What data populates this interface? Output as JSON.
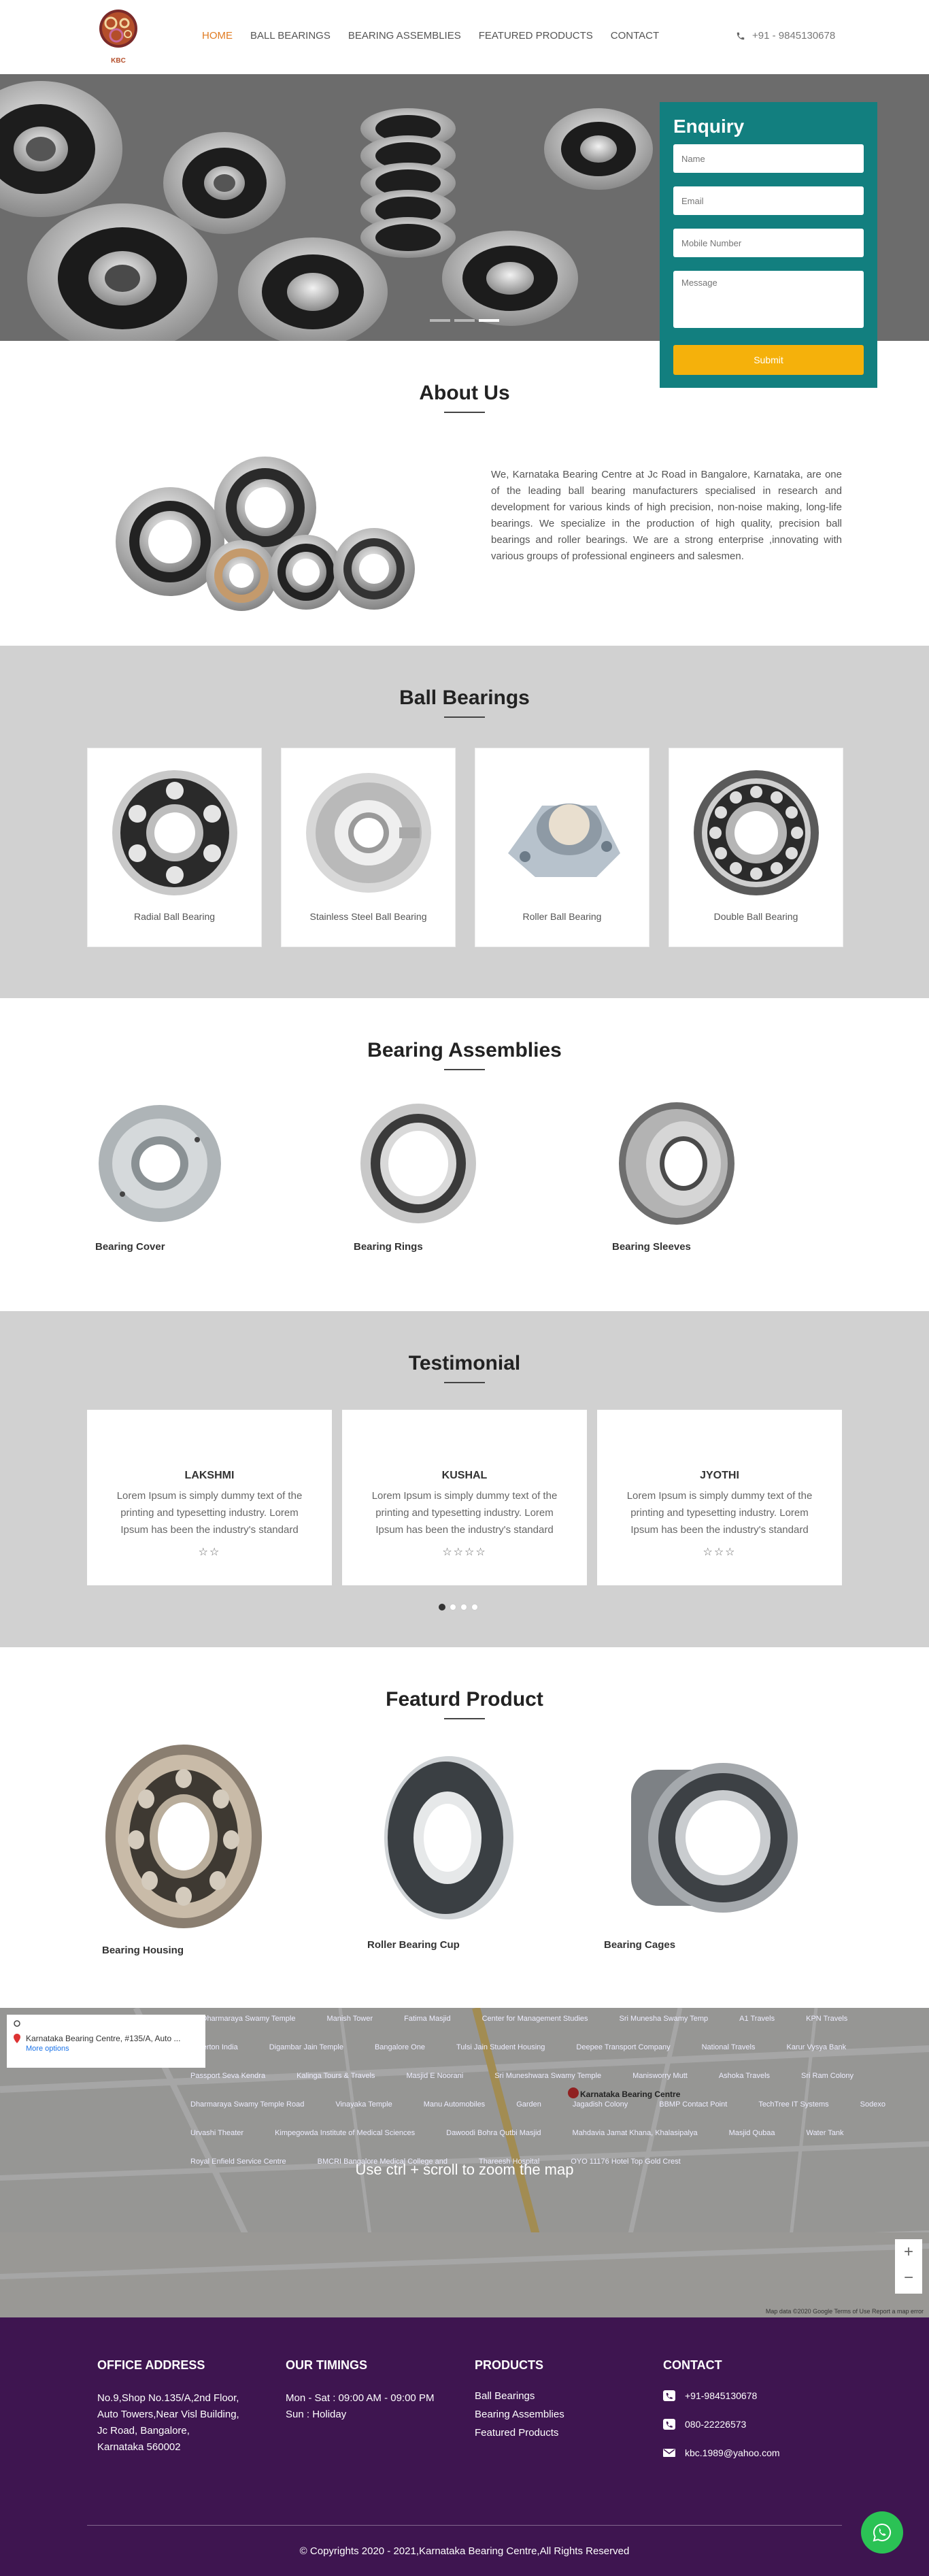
{
  "header": {
    "logo_text": "KBC",
    "nav": [
      "HOME",
      "BALL BEARINGS",
      "BEARING ASSEMBLIES",
      "FEATURED PRODUCTS",
      "CONTACT"
    ],
    "phone": "+91 - 9845130678"
  },
  "enquiry": {
    "title": "Enquiry",
    "name_ph": "Name",
    "email_ph": "Email",
    "mobile_ph": "Mobile Number",
    "message_ph": "Message",
    "submit": "Submit"
  },
  "about": {
    "title": "About Us",
    "text": "We, Karnataka Bearing Centre at Jc Road in Bangalore, Karnataka, are one of the leading ball bearing manufacturers specialised in research and development for various kinds of high precision, non-noise making, long-life bearings. We specialize in the production of high quality, precision ball bearings and roller bearings. We are a strong enterprise ,innovating with various groups of professional engineers and salesmen."
  },
  "ball_bearings": {
    "title": "Ball Bearings",
    "items": [
      "Radial Ball Bearing",
      "Stainless Steel Ball Bearing",
      "Roller Ball Bearing",
      "Double Ball Bearing"
    ]
  },
  "assemblies": {
    "title": "Bearing Assemblies",
    "items": [
      "Bearing Cover",
      "Bearing Rings",
      "Bearing Sleeves"
    ]
  },
  "testimonial": {
    "title": "Testimonial",
    "items": [
      {
        "name": "LAKSHMI",
        "text": "Lorem Ipsum is simply dummy text of the printing and typesetting industry. Lorem Ipsum has been the industry's standard",
        "stars": "☆☆"
      },
      {
        "name": "KUSHAL",
        "text": "Lorem Ipsum is simply dummy text of the printing and typesetting industry. Lorem Ipsum has been the industry's standard",
        "stars": "☆☆☆☆"
      },
      {
        "name": "JYOTHI",
        "text": "Lorem Ipsum is simply dummy text of the printing and typesetting industry. Lorem Ipsum has been the industry's standard",
        "stars": "☆☆☆"
      }
    ]
  },
  "featured": {
    "title": "Featurd Product",
    "items": [
      "Bearing Housing",
      "Roller Bearing Cup",
      "Bearing Cages"
    ]
  },
  "map": {
    "place": "Karnataka Bearing Centre, #135/A, Auto ...",
    "more": "More options",
    "hint": "Use ctrl + scroll to zoom the map",
    "marker": "Karnataka Bearing Centre",
    "labels": [
      "Sri Dharmaraya Swamy Temple",
      "Manish Tower",
      "Fatima Masjid",
      "Center for Management Studies",
      "Sri Munesha Swamy Temp",
      "A1 Travels",
      "KPN Travels",
      "Fullerton India",
      "Digambar Jain Temple",
      "Bangalore One",
      "Tulsi Jain Student Housing",
      "Deepee Transport Company",
      "National Travels",
      "Karur Vysya Bank",
      "Passport Seva Kendra",
      "Kalinga Tours & Travels",
      "Masjid E Noorani",
      "Sri Muneshwara Swamy Temple",
      "Manisworry Mutt",
      "Ashoka Travels",
      "Sri Ram Colony",
      "Dharmaraya Swamy Temple Road",
      "Vinayaka Temple",
      "Manu Automobiles",
      "Garden",
      "Jagadish Colony",
      "BBMP Contact Point",
      "TechTree IT Systems",
      "Sodexo",
      "Urvashi Theater",
      "Kimpegowda Institute of Medical Sciences",
      "Dawoodi Bohra Qutbi Masjid",
      "Mahdavia Jamat Khana, Khalasipalya",
      "Masjid Qubaa",
      "Water Tank",
      "Royal Enfield Service Centre",
      "BMCRI Bangalore Medical College and",
      "Thareesh Hospital",
      "OYO 11176 Hotel Top Gold Crest"
    ],
    "footer": "Map data ©2020 Google   Terms of Use   Report a map error"
  },
  "footer": {
    "office_title": "OFFICE ADDRESS",
    "office_lines": [
      "No.9,Shop No.135/A,2nd Floor,",
      "Auto Towers,Near Visl Building,",
      "Jc Road, Bangalore,",
      "Karnataka 560002"
    ],
    "timings_title": "OUR TIMINGS",
    "timings_lines": [
      "Mon - Sat : 09:00 AM - 09:00 PM",
      "Sun : Holiday"
    ],
    "products_title": "PRODUCTS",
    "products": [
      "Ball Bearings",
      "Bearing Assemblies",
      "Featured Products"
    ],
    "contact_title": "CONTACT",
    "contact": [
      "+91-9845130678",
      "080-22226573",
      "kbc.1989@yahoo.com"
    ],
    "copyright": "© Copyrights 2020 - 2021,Karnataka Bearing Centre,All Rights Reserved"
  },
  "colors": {
    "accent": "#e07b21",
    "teal": "#127f7f",
    "yellow": "#f5b10b",
    "footer": "#3e1550",
    "whatsapp": "#2bc255"
  }
}
